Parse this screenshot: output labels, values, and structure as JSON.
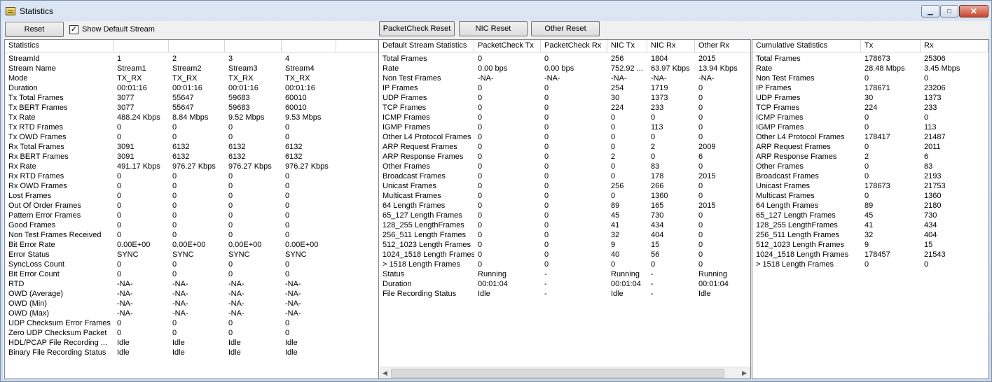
{
  "window": {
    "title": "Statistics",
    "controls": {
      "minimize": "▁",
      "maximize": "□",
      "close": "✕"
    }
  },
  "toolbar": {
    "reset": "Reset",
    "show_default_stream": "Show Default Stream",
    "show_default_checked": true,
    "packetcheck_reset": "PacketCheck Reset",
    "nic_reset": "NIC Reset",
    "other_reset": "Other Reset"
  },
  "left_panel": {
    "columns": [
      "Statistics",
      "",
      "",
      "",
      "",
      ""
    ],
    "rows": [
      [
        "StreamId",
        "1",
        "2",
        "3",
        "4"
      ],
      [
        "Stream Name",
        "Stream1",
        "Stream2",
        "Stream3",
        "Stream4"
      ],
      [
        "Mode",
        "TX_RX",
        "TX_RX",
        "TX_RX",
        "TX_RX"
      ],
      [
        "Duration",
        "00:01:16",
        "00:01:16",
        "00:01:16",
        "00:01:16"
      ],
      [
        "Tx Total Frames",
        "3077",
        "55647",
        "59683",
        "60010"
      ],
      [
        "Tx BERT Frames",
        "3077",
        "55647",
        "59683",
        "60010"
      ],
      [
        "Tx Rate",
        "488.24 Kbps",
        "8.84 Mbps",
        "9.52 Mbps",
        "9.53 Mbps"
      ],
      [
        "Tx RTD Frames",
        "0",
        "0",
        "0",
        "0"
      ],
      [
        "Tx OWD Frames",
        "0",
        "0",
        "0",
        "0"
      ],
      [
        "Rx Total Frames",
        "3091",
        "6132",
        "6132",
        "6132"
      ],
      [
        "Rx BERT Frames",
        "3091",
        "6132",
        "6132",
        "6132"
      ],
      [
        "Rx Rate",
        "491.17 Kbps",
        "976.27 Kbps",
        "976.27 Kbps",
        "976.27 Kbps"
      ],
      [
        "Rx RTD Frames",
        "0",
        "0",
        "0",
        "0"
      ],
      [
        "Rx OWD Frames",
        "0",
        "0",
        "0",
        "0"
      ],
      [
        "Lost Frames",
        "0",
        "0",
        "0",
        "0"
      ],
      [
        "Out Of Order Frames",
        "0",
        "0",
        "0",
        "0"
      ],
      [
        "Pattern Error Frames",
        "0",
        "0",
        "0",
        "0"
      ],
      [
        "Good Frames",
        "0",
        "0",
        "0",
        "0"
      ],
      [
        "Non Test Frames Received",
        "0",
        "0",
        "0",
        "0"
      ],
      [
        "Bit Error Rate",
        "0.00E+00",
        "0.00E+00",
        "0.00E+00",
        "0.00E+00"
      ],
      [
        "Error Status",
        "SYNC",
        "SYNC",
        "SYNC",
        "SYNC"
      ],
      [
        "SyncLoss Count",
        "0",
        "0",
        "0",
        "0"
      ],
      [
        "Bit Error Count",
        "0",
        "0",
        "0",
        "0"
      ],
      [
        "RTD",
        "-NA-",
        "-NA-",
        "-NA-",
        "-NA-"
      ],
      [
        "OWD (Average)",
        "-NA-",
        "-NA-",
        "-NA-",
        "-NA-"
      ],
      [
        "OWD (Min)",
        "-NA-",
        "-NA-",
        "-NA-",
        "-NA-"
      ],
      [
        "OWD (Max)",
        "-NA-",
        "-NA-",
        "-NA-",
        "-NA-"
      ],
      [
        "UDP Checksum Error Frames",
        "0",
        "0",
        "0",
        "0"
      ],
      [
        "Zero UDP Checksum Packet",
        "0",
        "0",
        "0",
        "0"
      ],
      [
        "HDL/PCAP File Recording ...",
        "Idle",
        "Idle",
        "Idle",
        "Idle"
      ],
      [
        "Binary File Recording Status",
        "Idle",
        "Idle",
        "Idle",
        "Idle"
      ]
    ]
  },
  "middle_panel": {
    "columns": [
      "Default Stream Statistics",
      "PacketCheck Tx",
      "PacketCheck Rx",
      "NIC Tx",
      "NIC Rx",
      "Other Rx"
    ],
    "rows": [
      [
        "Total Frames",
        "0",
        "0",
        "256",
        "1804",
        "2015"
      ],
      [
        "Rate",
        "0.00 bps",
        "0.00 bps",
        "752.92 ...",
        "63.97 Kbps",
        "13.94 Kbps"
      ],
      [
        "Non Test Frames",
        "-NA-",
        "-NA-",
        "-NA-",
        "-NA-",
        "-NA-"
      ],
      [
        "IP Frames",
        "0",
        "0",
        "254",
        "1719",
        "0"
      ],
      [
        "UDP Frames",
        "0",
        "0",
        "30",
        "1373",
        "0"
      ],
      [
        "TCP Frames",
        "0",
        "0",
        "224",
        "233",
        "0"
      ],
      [
        "ICMP Frames",
        "0",
        "0",
        "0",
        "0",
        "0"
      ],
      [
        "IGMP Frames",
        "0",
        "0",
        "0",
        "113",
        "0"
      ],
      [
        "Other L4 Protocol Frames",
        "0",
        "0",
        "0",
        "0",
        "0"
      ],
      [
        "ARP Request Frames",
        "0",
        "0",
        "0",
        "2",
        "2009"
      ],
      [
        "ARP Response Frames",
        "0",
        "0",
        "2",
        "0",
        "6"
      ],
      [
        "Other Frames",
        "0",
        "0",
        "0",
        "83",
        "0"
      ],
      [
        "Broadcast Frames",
        "0",
        "0",
        "0",
        "178",
        "2015"
      ],
      [
        "Unicast Frames",
        "0",
        "0",
        "256",
        "266",
        "0"
      ],
      [
        "Multicast Frames",
        "0",
        "0",
        "0",
        "1360",
        "0"
      ],
      [
        "64 Length Frames",
        "0",
        "0",
        "89",
        "165",
        "2015"
      ],
      [
        "65_127 Length Frames",
        "0",
        "0",
        "45",
        "730",
        "0"
      ],
      [
        "128_255 LengthFrames",
        "0",
        "0",
        "41",
        "434",
        "0"
      ],
      [
        "256_511 Length Frames",
        "0",
        "0",
        "32",
        "404",
        "0"
      ],
      [
        "512_1023 Length Frames",
        "0",
        "0",
        "9",
        "15",
        "0"
      ],
      [
        "1024_1518 Length Frames",
        "0",
        "0",
        "40",
        "56",
        "0"
      ],
      [
        "> 1518 Length Frames",
        "0",
        "0",
        "0",
        "0",
        "0"
      ],
      [
        "Status",
        "Running",
        "-",
        "Running",
        "-",
        "Running"
      ],
      [
        "Duration",
        "00:01:04",
        "-",
        "00:01:04",
        "-",
        "00:01:04"
      ],
      [
        "File Recording Status",
        "Idle",
        "-",
        "Idle",
        "-",
        "Idle"
      ]
    ]
  },
  "right_panel": {
    "columns": [
      "Cumulative Statistics",
      "Tx",
      "Rx"
    ],
    "rows": [
      [
        "Total Frames",
        "178673",
        "25306"
      ],
      [
        "Rate",
        "28.48 Mbps",
        "3.45 Mbps"
      ],
      [
        "Non Test Frames",
        "0",
        "0"
      ],
      [
        "IP Frames",
        "178671",
        "23206"
      ],
      [
        "UDP Frames",
        "30",
        "1373"
      ],
      [
        "TCP Frames",
        "224",
        "233"
      ],
      [
        "ICMP Frames",
        "0",
        "0"
      ],
      [
        "IGMP Frames",
        "0",
        "113"
      ],
      [
        "Other L4 Protocol Frames",
        "178417",
        "21487"
      ],
      [
        "ARP Request Frames",
        "0",
        "2011"
      ],
      [
        "ARP Response Frames",
        "2",
        "6"
      ],
      [
        "Other Frames",
        "0",
        "83"
      ],
      [
        "Broadcast Frames",
        "0",
        "2193"
      ],
      [
        "Unicast Frames",
        "178673",
        "21753"
      ],
      [
        "Multicast Frames",
        "0",
        "1360"
      ],
      [
        "64 Length Frames",
        "89",
        "2180"
      ],
      [
        "65_127 Length Frames",
        "45",
        "730"
      ],
      [
        "128_255 LengthFrames",
        "41",
        "434"
      ],
      [
        "256_511 Length Frames",
        "32",
        "404"
      ],
      [
        "512_1023 Length Frames",
        "9",
        "15"
      ],
      [
        "1024_1518 Length Frames",
        "178457",
        "21543"
      ],
      [
        "> 1518 Length Frames",
        "0",
        "0"
      ]
    ]
  },
  "scrollbar": {
    "left_arrow": "◀",
    "right_arrow": "▶"
  }
}
